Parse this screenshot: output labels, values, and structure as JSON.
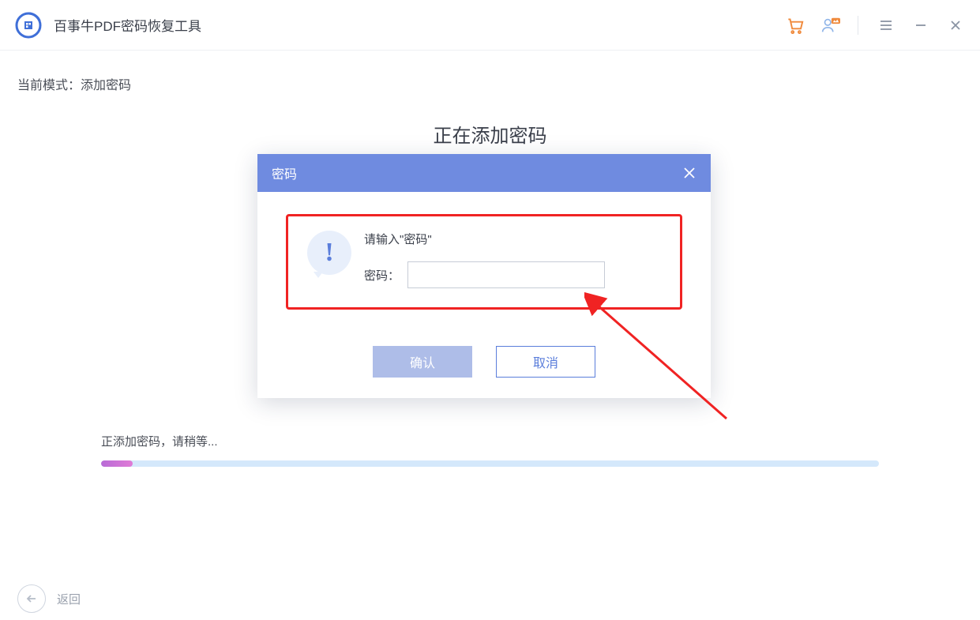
{
  "app": {
    "title": "百事牛PDF密码恢复工具"
  },
  "mode": {
    "label": "当前模式：",
    "value": "添加密码"
  },
  "main": {
    "title": "正在添加密码"
  },
  "progress": {
    "text": "正添加密码，请稍等..."
  },
  "modal": {
    "title": "密码",
    "prompt": "请输入\"密码\"",
    "password_label": "密码：",
    "password_value": "",
    "confirm": "确认",
    "cancel": "取消"
  },
  "footer": {
    "back": "返回"
  }
}
